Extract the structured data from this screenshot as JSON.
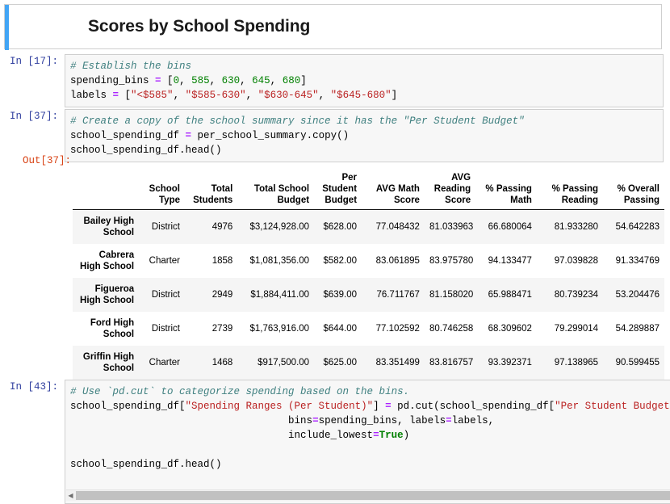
{
  "notebook": {
    "title": "Scores by School Spending",
    "cells": [
      {
        "type": "markdown",
        "selected": true,
        "title": "Scores by School Spending"
      },
      {
        "type": "code",
        "prompt": "In [17]:",
        "lines": [
          [
            {
              "t": "# Establish the bins",
              "c": "c"
            }
          ],
          [
            {
              "t": "spending_bins ",
              "c": "n"
            },
            {
              "t": "=",
              "c": "o"
            },
            {
              "t": " [",
              "c": "b"
            },
            {
              "t": "0",
              "c": "m"
            },
            {
              "t": ", ",
              "c": "b"
            },
            {
              "t": "585",
              "c": "m"
            },
            {
              "t": ", ",
              "c": "b"
            },
            {
              "t": "630",
              "c": "m"
            },
            {
              "t": ", ",
              "c": "b"
            },
            {
              "t": "645",
              "c": "m"
            },
            {
              "t": ", ",
              "c": "b"
            },
            {
              "t": "680",
              "c": "m"
            },
            {
              "t": "]",
              "c": "b"
            }
          ],
          [
            {
              "t": "labels ",
              "c": "n"
            },
            {
              "t": "=",
              "c": "o"
            },
            {
              "t": " [",
              "c": "b"
            },
            {
              "t": "\"<$585\"",
              "c": "s"
            },
            {
              "t": ", ",
              "c": "b"
            },
            {
              "t": "\"$585-630\"",
              "c": "s"
            },
            {
              "t": ", ",
              "c": "b"
            },
            {
              "t": "\"$630-645\"",
              "c": "s"
            },
            {
              "t": ", ",
              "c": "b"
            },
            {
              "t": "\"$645-680\"",
              "c": "s"
            },
            {
              "t": "]",
              "c": "b"
            }
          ]
        ]
      },
      {
        "type": "code",
        "prompt": "In [37]:",
        "lines": [
          [
            {
              "t": "# Create a copy of the school summary since it has the \"Per Student Budget\"",
              "c": "c"
            }
          ],
          [
            {
              "t": "school_spending_df ",
              "c": "n"
            },
            {
              "t": "=",
              "c": "o"
            },
            {
              "t": " per_school_summary.copy()",
              "c": "b"
            }
          ],
          [
            {
              "t": "school_spending_df.head()",
              "c": "b"
            }
          ]
        ]
      },
      {
        "type": "output",
        "prompt": "Out[37]:"
      },
      {
        "type": "code",
        "prompt": "In [43]:",
        "has_scrollbar": true,
        "lines": [
          [
            {
              "t": "# Use `pd.cut` to categorize spending based on the bins.",
              "c": "c"
            }
          ],
          [
            {
              "t": "school_spending_df[",
              "c": "b"
            },
            {
              "t": "\"Spending Ranges (Per Student)\"",
              "c": "s"
            },
            {
              "t": "] ",
              "c": "b"
            },
            {
              "t": "=",
              "c": "o"
            },
            {
              "t": " pd.cut(school_spending_df[",
              "c": "b"
            },
            {
              "t": "\"Per Student Budget\"",
              "c": "s"
            },
            {
              "t": "],",
              "c": "b"
            }
          ],
          [
            {
              "t": "                                    bins",
              "c": "b"
            },
            {
              "t": "=",
              "c": "o"
            },
            {
              "t": "spending_bins, labels",
              "c": "b"
            },
            {
              "t": "=",
              "c": "o"
            },
            {
              "t": "labels,",
              "c": "b"
            }
          ],
          [
            {
              "t": "                                    include_lowest",
              "c": "b"
            },
            {
              "t": "=",
              "c": "o"
            },
            {
              "t": "True",
              "c": "k"
            },
            {
              "t": ")",
              "c": "b"
            }
          ],
          [
            {
              "t": "",
              "c": "b"
            }
          ],
          [
            {
              "t": "school_spending_df.head()",
              "c": "b"
            }
          ]
        ]
      }
    ]
  },
  "dataframe": {
    "index_header": "",
    "columns": [
      "School Type",
      "Total Students",
      "Total School Budget",
      "Per Student Budget",
      "AVG Math Score",
      "AVG Reading Score",
      "% Passing Math",
      "% Passing Reading",
      "% Overall Passing"
    ],
    "rows": [
      {
        "index": "Bailey High School",
        "values": [
          "District",
          "4976",
          "$3,124,928.00",
          "$628.00",
          "77.048432",
          "81.033963",
          "66.680064",
          "81.933280",
          "54.642283"
        ]
      },
      {
        "index": "Cabrera High School",
        "values": [
          "Charter",
          "1858",
          "$1,081,356.00",
          "$582.00",
          "83.061895",
          "83.975780",
          "94.133477",
          "97.039828",
          "91.334769"
        ]
      },
      {
        "index": "Figueroa High School",
        "values": [
          "District",
          "2949",
          "$1,884,411.00",
          "$639.00",
          "76.711767",
          "81.158020",
          "65.988471",
          "80.739234",
          "53.204476"
        ]
      },
      {
        "index": "Ford High School",
        "values": [
          "District",
          "2739",
          "$1,763,916.00",
          "$644.00",
          "77.102592",
          "80.746258",
          "68.309602",
          "79.299014",
          "54.289887"
        ]
      },
      {
        "index": "Griffin High School",
        "values": [
          "Charter",
          "1468",
          "$917,500.00",
          "$625.00",
          "83.351499",
          "83.816757",
          "93.392371",
          "97.138965",
          "90.599455"
        ]
      }
    ]
  },
  "scrollbar": {
    "left_arrow": "◀",
    "right_arrow": "▶"
  },
  "colors": {
    "selection_bar": "#42A5F5",
    "in_prompt": "#303F9F",
    "out_prompt": "#D84315",
    "comment": "#408080",
    "string": "#BA2121",
    "number": "#008000",
    "keyword": "#008000",
    "operator": "#AA22FF",
    "code_background": "#f7f7f7",
    "row_stripe": "#f5f5f5"
  }
}
